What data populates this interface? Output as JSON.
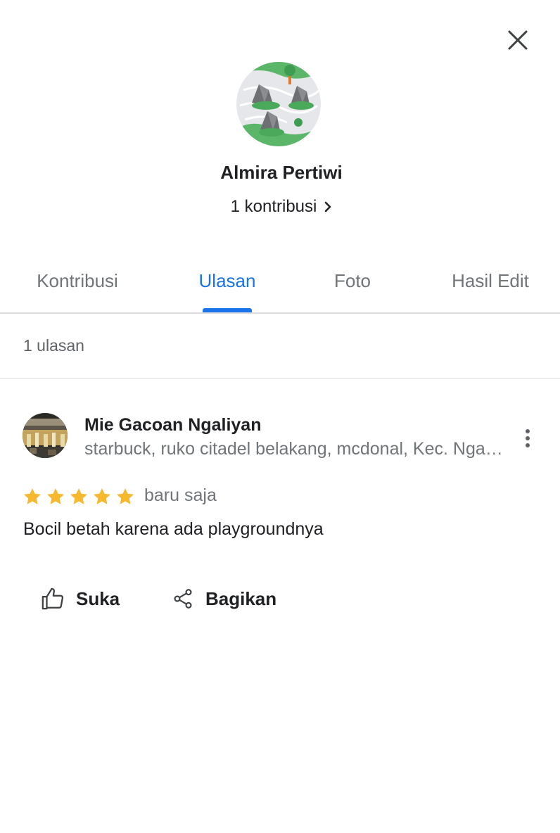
{
  "profile": {
    "name": "Almira Pertiwi",
    "contributions_label": "1 kontribusi"
  },
  "tabs": [
    {
      "label": "Kontribusi",
      "active": false
    },
    {
      "label": "Ulasan",
      "active": true
    },
    {
      "label": "Foto",
      "active": false
    },
    {
      "label": "Hasil Edit",
      "active": false
    }
  ],
  "reviews_summary": "1 ulasan",
  "review": {
    "place_name": "Mie Gacoan Ngaliyan",
    "place_address": "starbuck, ruko citadel belakang, mcdonal, Kec. Ngaliyan",
    "rating": 5,
    "time": "baru saja",
    "text": "Bocil betah karena ada playgroundnya"
  },
  "actions": {
    "like_label": "Suka",
    "share_label": "Bagikan"
  },
  "colors": {
    "accent": "#1a73e8",
    "star": "#f5b82e",
    "text_primary": "#202124",
    "text_secondary": "#70757a"
  }
}
